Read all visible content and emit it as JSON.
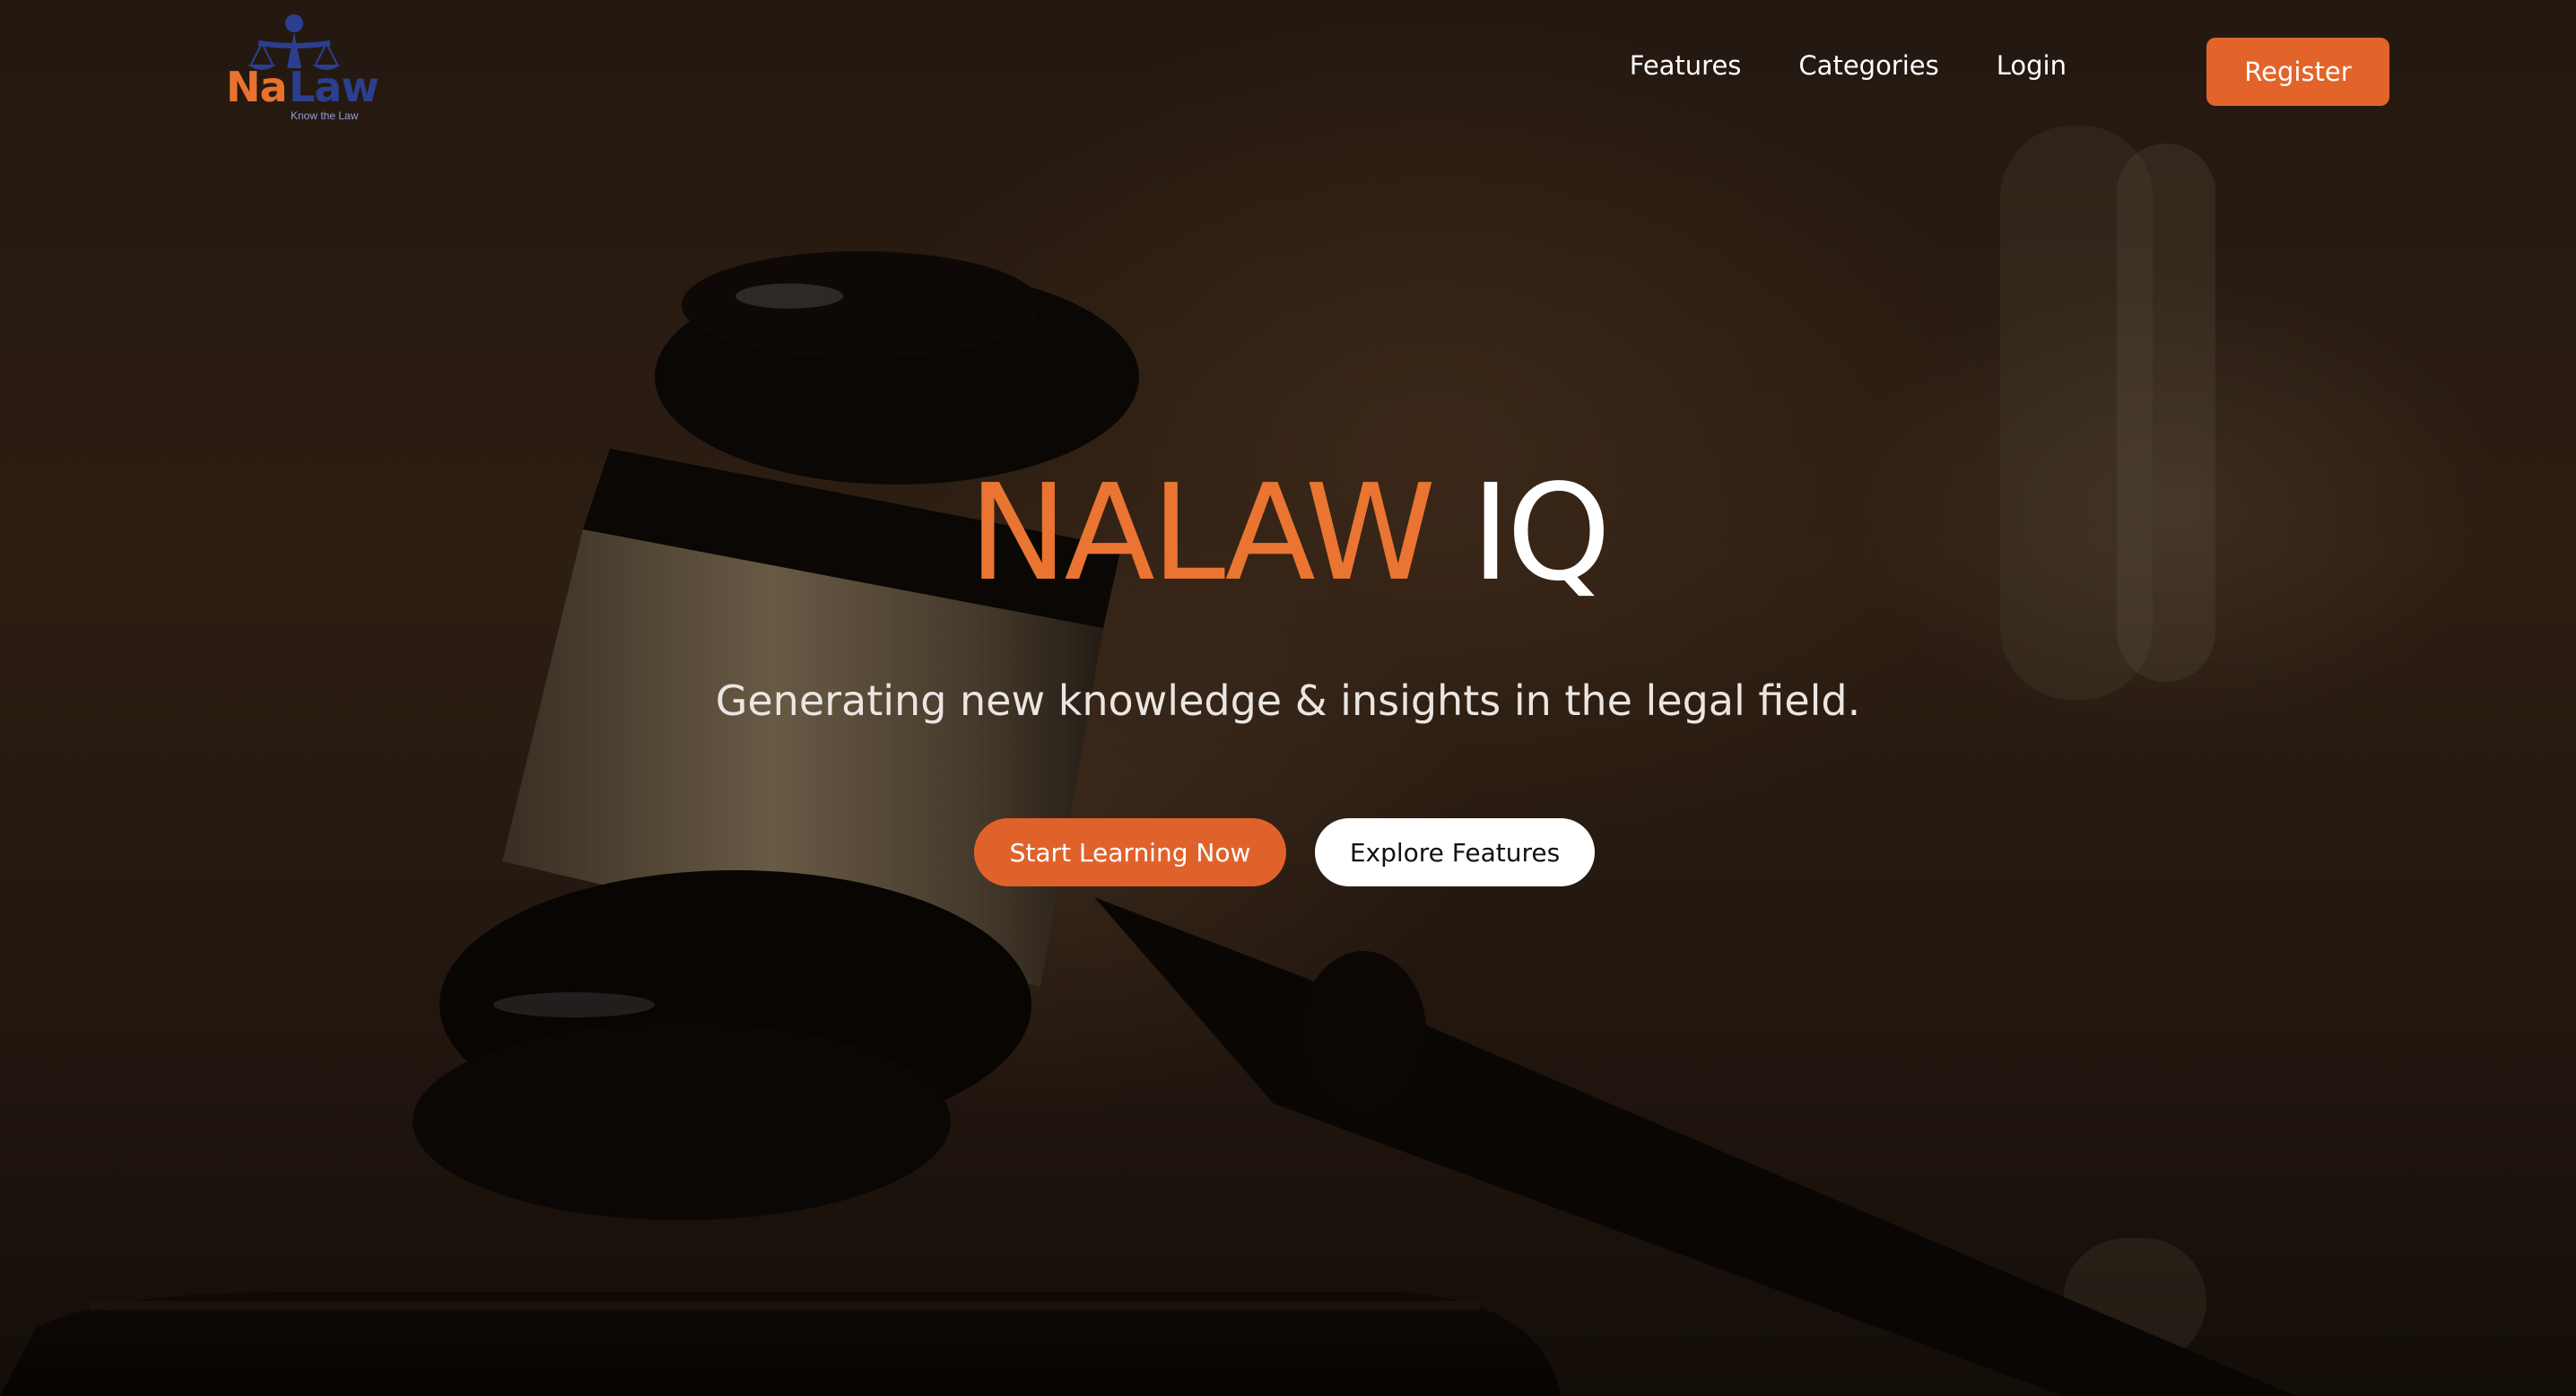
{
  "brand": {
    "logo_part_1": "Na",
    "logo_part_2": "Law",
    "tagline": "Know the Law",
    "accent_color": "#e2642a",
    "secondary_color": "#2b3f8f"
  },
  "nav": {
    "links": [
      {
        "label": "Features"
      },
      {
        "label": "Categories"
      },
      {
        "label": "Login"
      }
    ],
    "register_label": "Register"
  },
  "hero": {
    "title_accent": "NALAW",
    "title_rest": "IQ",
    "subtitle": "Generating new knowledge & insights in the legal field.",
    "background_image": "judge-gavel-icon",
    "primary_cta": "Start Learning Now",
    "secondary_cta": "Explore Features"
  }
}
